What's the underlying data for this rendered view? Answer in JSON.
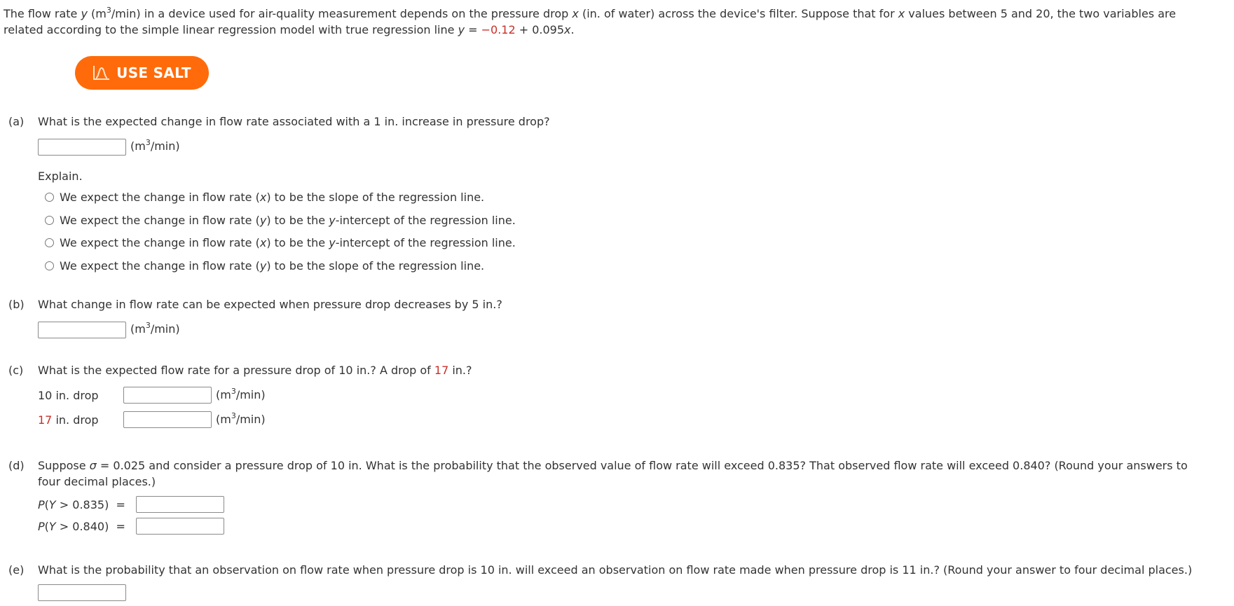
{
  "intro": {
    "line1_a": "The flow rate ",
    "var_y": "y",
    "line1_b": " (m",
    "sup3": "3",
    "line1_c": "/min) in a device used for air-quality measurement depends on the pressure drop ",
    "var_x": "x",
    "line1_d": " (in. of water) across the device's filter. Suppose that for ",
    "line1_e": " values between 5 and 20, the two variables are",
    "line2_a": "related according to the simple linear regression model with true regression line ",
    "line2_eq": " = ",
    "intercept": "−0.12",
    "line2_b": " + 0.095",
    "line2_end": "."
  },
  "salt_button": {
    "label": "USE SALT",
    "icon": "salt-graph-icon",
    "color": "#ff6b0a"
  },
  "unit": {
    "prefix": "(m",
    "sup": "3",
    "suffix": "/min)"
  },
  "parts": {
    "a": {
      "label": "(a)",
      "question": "What is the expected change in flow rate associated with a 1 in. increase in pressure drop?",
      "answer": "",
      "explain_label": "Explain.",
      "options": [
        {
          "pre": "We expect the change in flow rate (",
          "var": "x",
          "mid": ") to be the slope of the regression line.",
          "post": ""
        },
        {
          "pre": "We expect the change in flow rate (",
          "var": "y",
          "mid": ") to be the ",
          "var2": "y",
          "post": "-intercept of the regression line."
        },
        {
          "pre": "We expect the change in flow rate (",
          "var": "x",
          "mid": ") to be the ",
          "var2": "y",
          "post": "-intercept of the regression line."
        },
        {
          "pre": "We expect the change in flow rate (",
          "var": "y",
          "mid": ") to be the slope of the regression line.",
          "post": ""
        }
      ]
    },
    "b": {
      "label": "(b)",
      "question": "What change in flow rate can be expected when pressure drop decreases by 5 in.?",
      "answer": ""
    },
    "c": {
      "label": "(c)",
      "question_a": "What is the expected flow rate for a pressure drop of 10 in.? A drop of ",
      "question_red": "17",
      "question_b": " in.?",
      "row1_label": "10 in. drop",
      "row2_red": "17",
      "row2_label": " in. drop",
      "answer1": "",
      "answer2": ""
    },
    "d": {
      "label": "(d)",
      "q_a": "Suppose ",
      "sigma": "σ",
      "q_b": " = 0.025 and consider a pressure drop of 10 in. What is the probability that the observed value of flow rate will exceed 0.835? That observed flow rate will exceed 0.840? (Round your answers to",
      "q_line2": "four decimal places.)",
      "p1_P": "P",
      "p1_open": "(",
      "p1_Y": "Y",
      "p1_rest": " > 0.835)  =",
      "p2_rest": " > 0.840)  =",
      "answer1": "",
      "answer2": ""
    },
    "e": {
      "label": "(e)",
      "question": "What is the probability that an observation on flow rate when pressure drop is 10 in. will exceed an observation on flow rate made when pressure drop is 11 in.? (Round your answer to four decimal places.)",
      "answer": ""
    }
  }
}
